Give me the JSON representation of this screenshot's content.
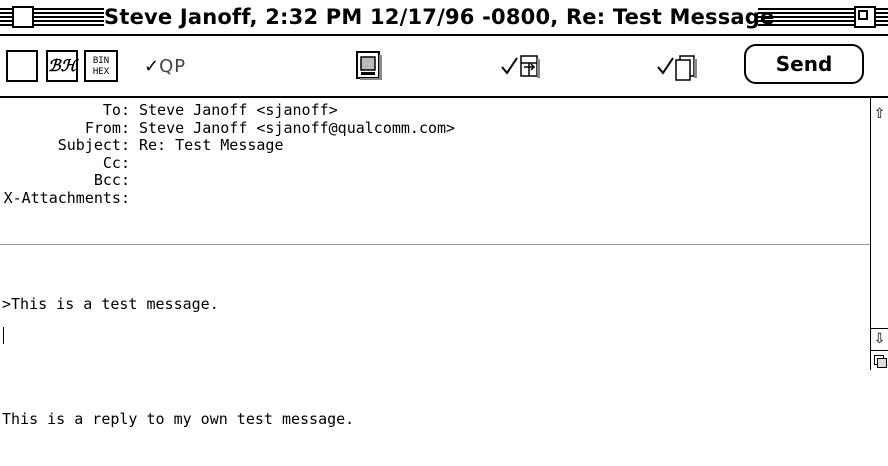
{
  "window": {
    "title": "Steve Janoff, 2:32 PM 12/17/96 -0800, Re: Test Message"
  },
  "toolbar": {
    "signature_label": "ℬℋ",
    "binhex_line1": "BIN",
    "binhex_line2": "HEX",
    "qp_check": "✓",
    "qp_label": "QP",
    "send_label": "Send",
    "icons": [
      "blank-option-icon",
      "signature-icon",
      "binhex-icon",
      "quoted-printable-icon",
      "text-document-icon",
      "tabs-in-body-icon",
      "keep-copies-icon"
    ]
  },
  "headers": [
    {
      "label": "To:",
      "value": "Steve Janoff <sjanoff>"
    },
    {
      "label": "From:",
      "value": "Steve Janoff <sjanoff@qualcomm.com>"
    },
    {
      "label": "Subject:",
      "value": "Re: Test Message"
    },
    {
      "label": "Cc:",
      "value": ""
    },
    {
      "label": "Bcc:",
      "value": ""
    },
    {
      "label": "X-Attachments:",
      "value": ""
    }
  ],
  "body": {
    "lines": [
      ">This is a test message.",
      "",
      "This is a reply to my own test message."
    ]
  },
  "scrollbar": {
    "up_arrow": "⇧",
    "down_arrow": "⇩"
  }
}
